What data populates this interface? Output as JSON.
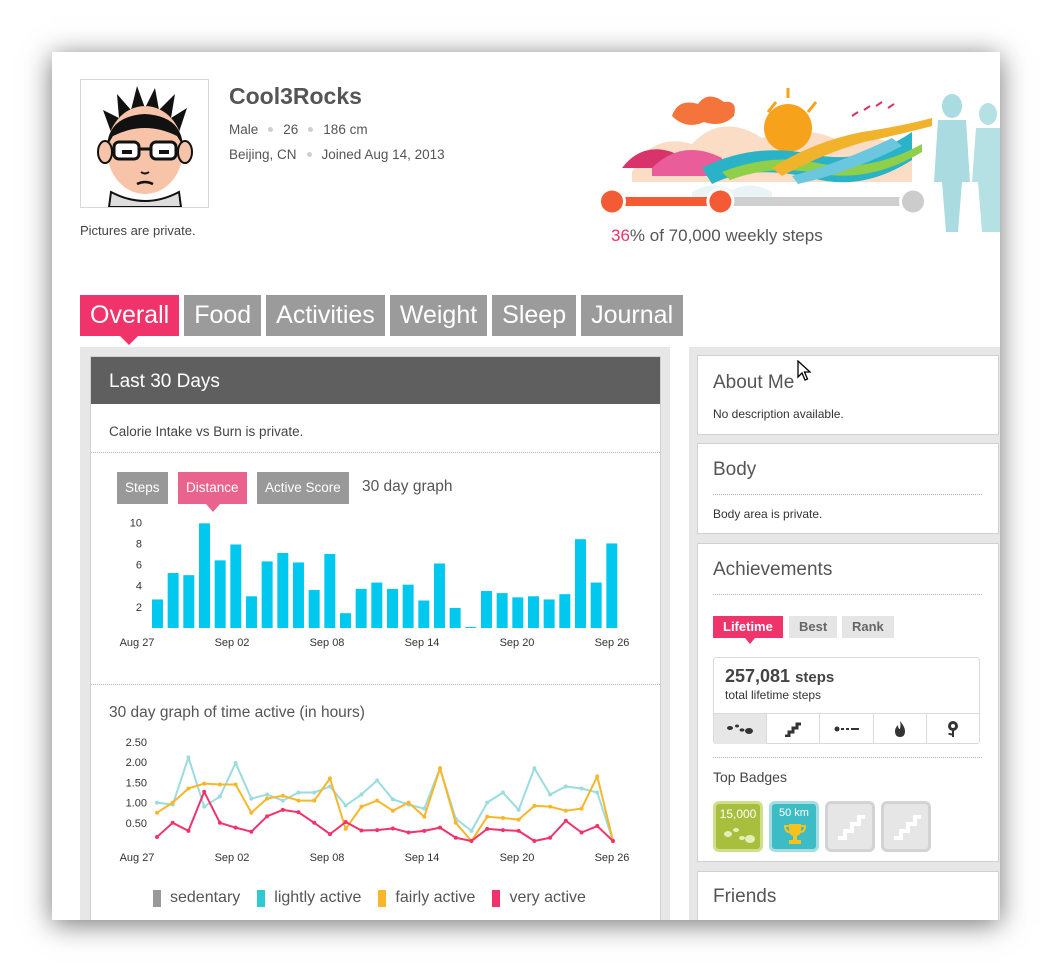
{
  "profile": {
    "username": "Cool3Rocks",
    "gender": "Male",
    "age": "26",
    "height": "186 cm",
    "location": "Beijing, CN",
    "joined": "Joined Aug 14, 2013",
    "pictures_note": "Pictures are private."
  },
  "weekly_goal": {
    "percent_text": "36",
    "caption_rest": "% of 70,000 weekly steps",
    "progress_fraction": 0.36
  },
  "tabs": [
    {
      "label": "Overall",
      "active": true
    },
    {
      "label": "Food",
      "active": false
    },
    {
      "label": "Activities",
      "active": false
    },
    {
      "label": "Weight",
      "active": false
    },
    {
      "label": "Sleep",
      "active": false
    },
    {
      "label": "Journal",
      "active": false
    }
  ],
  "main": {
    "section_title": "Last 30 Days",
    "calorie_note": "Calorie Intake vs Burn is private.",
    "graph_buttons": [
      "Steps",
      "Distance",
      "Active Score"
    ],
    "graph_caption": "30 day graph",
    "activity_title": "30 day graph of time active (in hours)"
  },
  "chart_data": [
    {
      "type": "bar",
      "title": "",
      "xlabel": "",
      "ylabel": "",
      "x_tick_labels": [
        "Aug 27",
        "Sep 02",
        "Sep 08",
        "Sep 14",
        "Sep 20",
        "Sep 26"
      ],
      "y_ticks": [
        2,
        4,
        6,
        8,
        10
      ],
      "ylim": [
        0,
        10.5
      ],
      "color": "#00c8ee",
      "values": [
        2.7,
        5.2,
        5.0,
        9.9,
        6.4,
        7.9,
        3.0,
        6.3,
        7.1,
        6.2,
        3.6,
        7.0,
        1.4,
        3.7,
        4.3,
        3.7,
        4.1,
        2.6,
        6.1,
        1.9,
        0.1,
        3.5,
        3.3,
        2.9,
        3.0,
        2.7,
        3.2,
        8.4,
        4.3,
        8.0
      ]
    },
    {
      "type": "line",
      "title": "",
      "xlabel": "",
      "ylabel": "",
      "x_tick_labels": [
        "Aug 27",
        "Sep 02",
        "Sep 08",
        "Sep 14",
        "Sep 20",
        "Sep 26"
      ],
      "y_ticks": [
        "0.50",
        "1.00",
        "1.50",
        "2.00",
        "2.50"
      ],
      "ylim": [
        0,
        2.6
      ],
      "series": [
        {
          "name": "sedentary",
          "color": "#999999",
          "values": []
        },
        {
          "name": "lightly active",
          "color": "#9adcdf",
          "values": [
            1.0,
            0.95,
            2.12,
            0.9,
            1.15,
            1.98,
            1.1,
            1.2,
            1.05,
            1.25,
            1.25,
            1.4,
            0.93,
            1.2,
            1.55,
            1.08,
            0.95,
            0.85,
            1.85,
            0.6,
            0.3,
            1.0,
            1.25,
            0.82,
            1.85,
            1.2,
            1.4,
            1.35,
            1.25,
            0.05
          ]
        },
        {
          "name": "fairly active",
          "color": "#f8b62b",
          "values": [
            0.75,
            1.0,
            1.35,
            1.47,
            1.45,
            1.45,
            0.75,
            1.1,
            1.17,
            1.05,
            1.05,
            1.6,
            0.35,
            0.9,
            1.05,
            0.8,
            1.0,
            0.65,
            1.85,
            0.5,
            0.05,
            0.65,
            0.62,
            0.58,
            0.92,
            0.9,
            0.8,
            0.85,
            1.65,
            0.05
          ]
        },
        {
          "name": "very active",
          "color": "#f0336a",
          "values": [
            0.15,
            0.5,
            0.3,
            1.27,
            0.5,
            0.38,
            0.28,
            0.66,
            0.82,
            0.76,
            0.5,
            0.22,
            0.52,
            0.31,
            0.32,
            0.36,
            0.26,
            0.3,
            0.38,
            0.13,
            0.05,
            0.35,
            0.32,
            0.3,
            0.05,
            0.13,
            0.55,
            0.26,
            0.42,
            0.05
          ]
        }
      ]
    }
  ],
  "sidebar": {
    "about_title": "About Me",
    "about_text": "No description available.",
    "body_title": "Body",
    "body_text": "Body area is private.",
    "achievements_title": "Achievements",
    "achievement_tabs": [
      {
        "label": "Lifetime",
        "active": true
      },
      {
        "label": "Best",
        "active": false
      },
      {
        "label": "Rank",
        "active": false
      }
    ],
    "lifetime_steps": "257,081",
    "lifetime_unit": "steps",
    "lifetime_label": "total lifetime steps",
    "metric_icons": [
      "footsteps-icon",
      "stairs-icon",
      "distance-icon",
      "flame-icon",
      "flower-icon"
    ],
    "top_badges_title": "Top Badges",
    "badges": [
      {
        "label": "15,000",
        "icon": "footsteps-badge-icon",
        "color": "#a7bf3c"
      },
      {
        "label": "50 km",
        "icon": "trophy-badge-icon",
        "color": "#3ebcc6"
      },
      {
        "label": "",
        "icon": "stairs-badge-icon",
        "color": "#e6e6e6"
      },
      {
        "label": "",
        "icon": "stairs-badge-icon",
        "color": "#e6e6e6"
      }
    ],
    "friends_title": "Friends"
  }
}
